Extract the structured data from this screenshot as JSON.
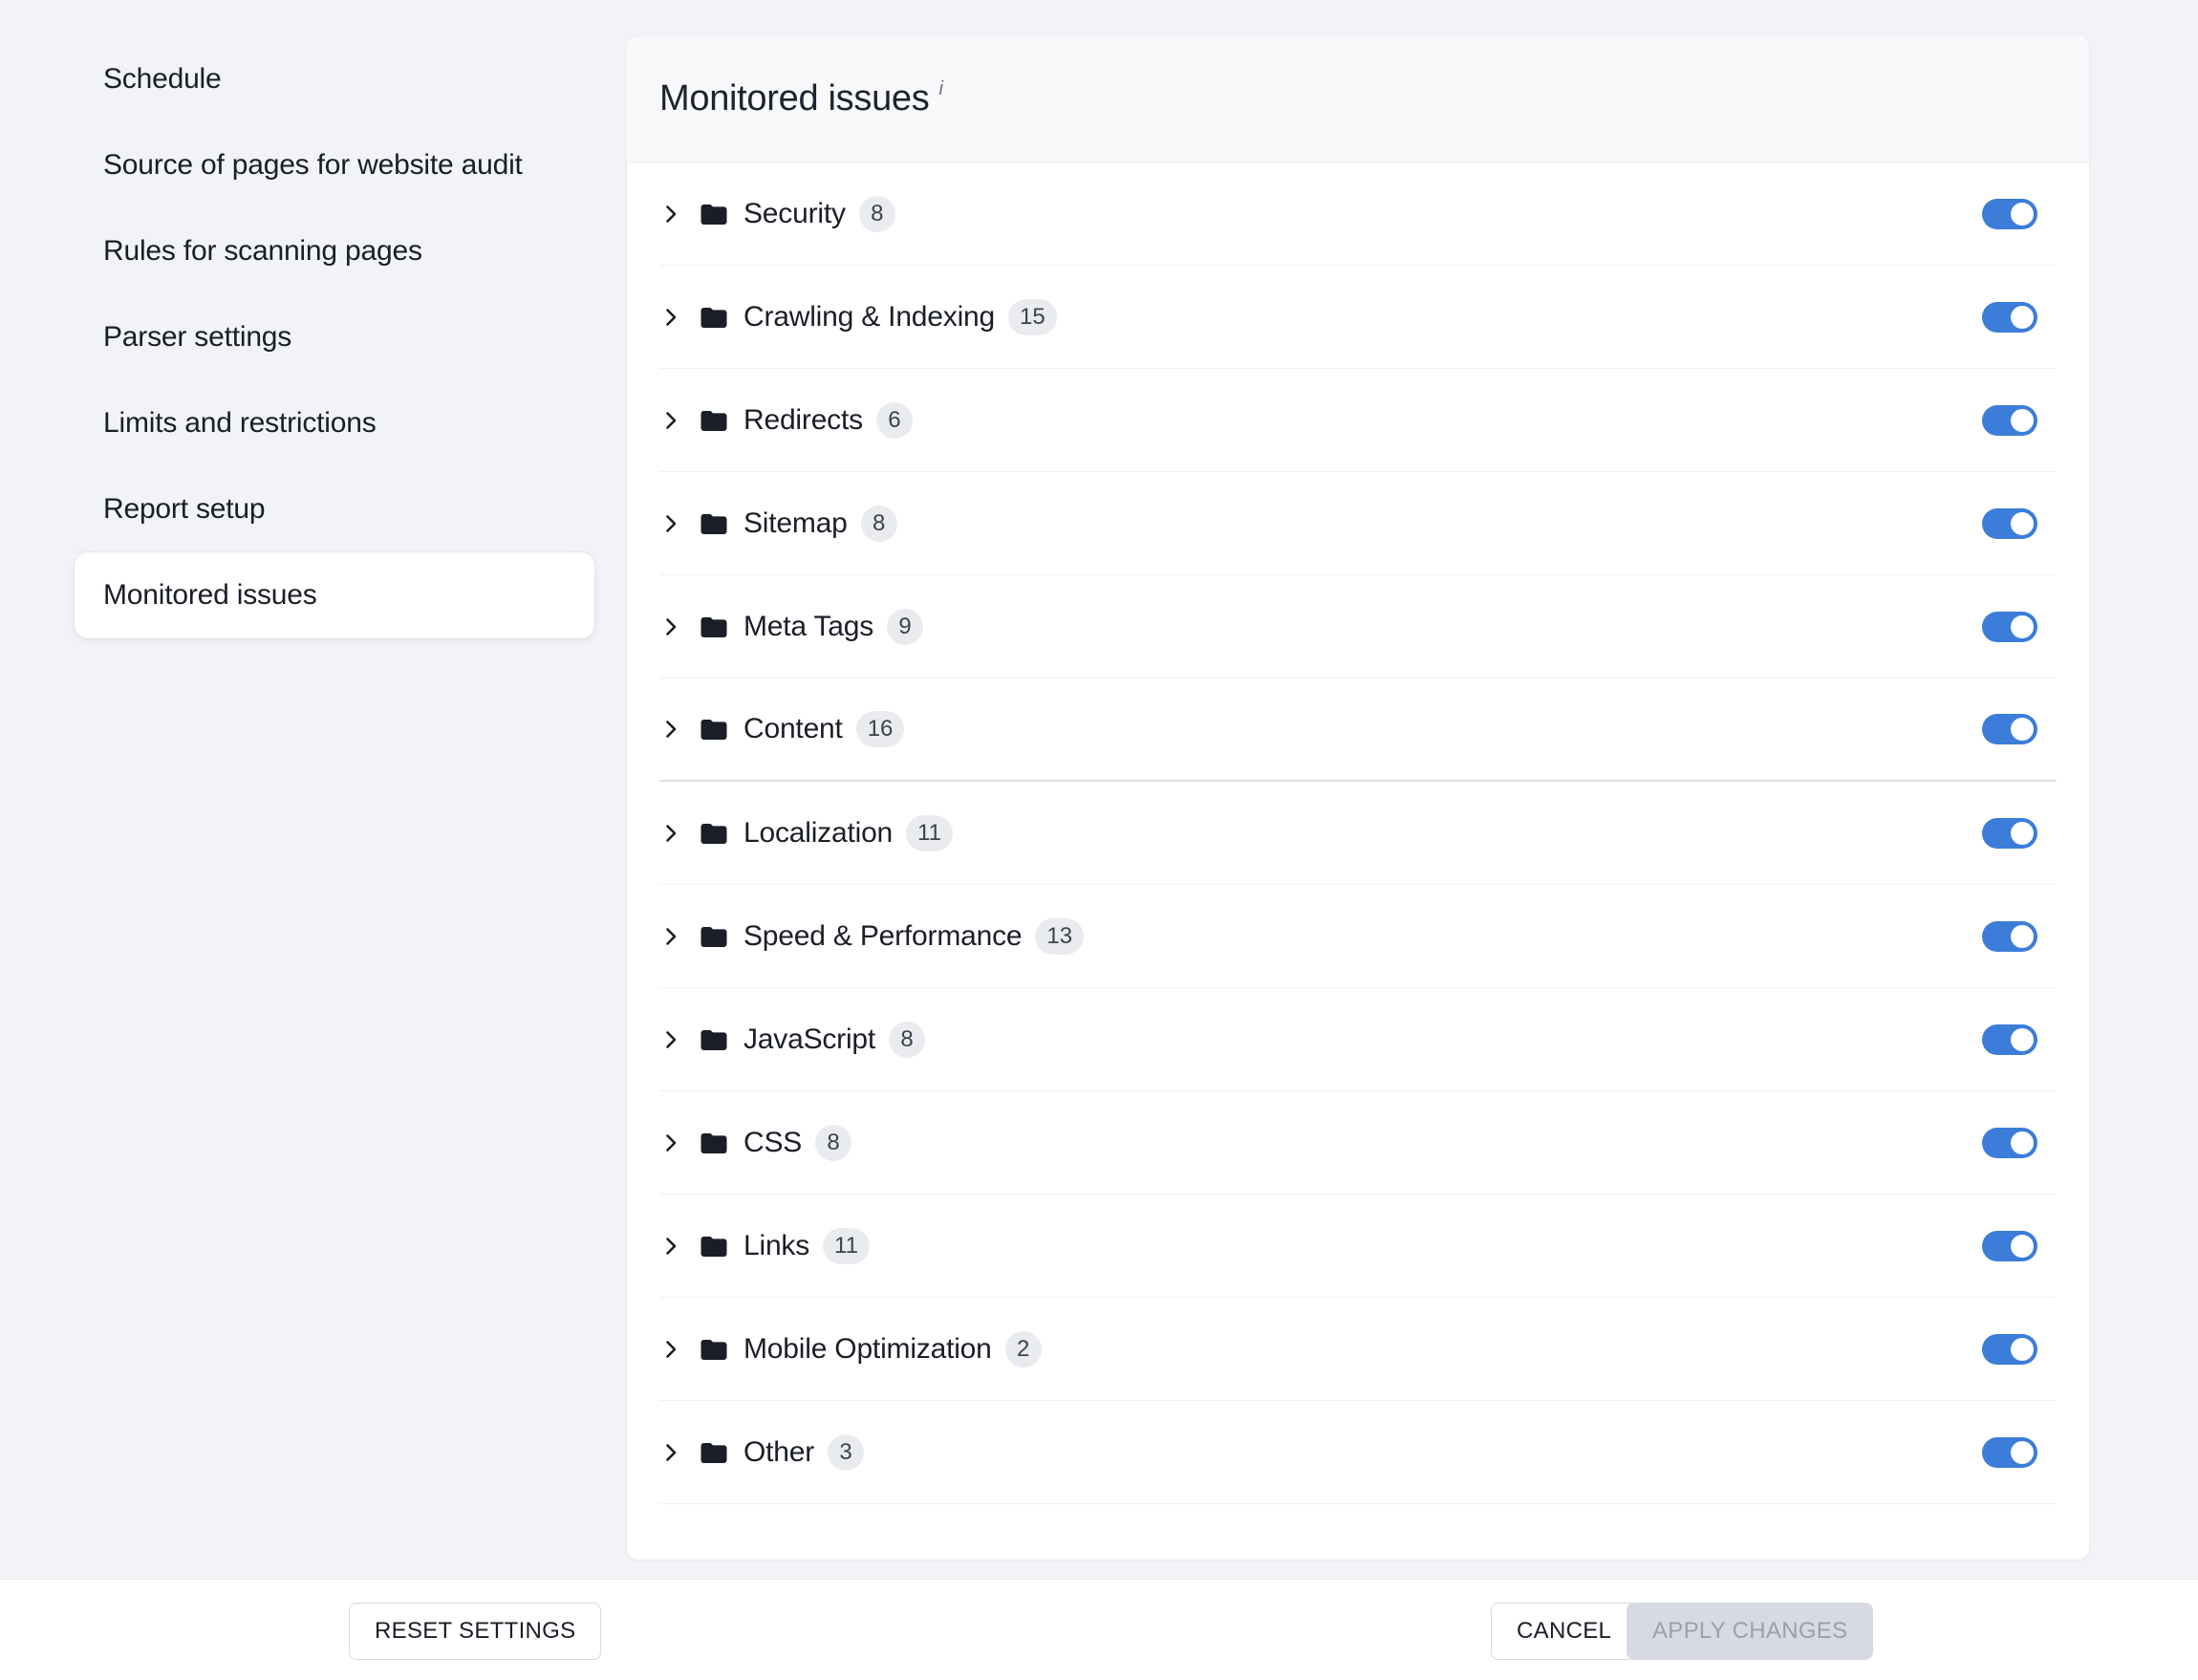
{
  "sidebar": {
    "items": [
      {
        "label": "Schedule",
        "active": false
      },
      {
        "label": "Source of pages for website audit",
        "active": false
      },
      {
        "label": "Rules for scanning pages",
        "active": false
      },
      {
        "label": "Parser settings",
        "active": false
      },
      {
        "label": "Limits and restrictions",
        "active": false
      },
      {
        "label": "Report setup",
        "active": false
      },
      {
        "label": "Monitored issues",
        "active": true
      }
    ]
  },
  "card": {
    "title": "Monitored issues",
    "info_icon": "i",
    "info_icon_name": "info-icon"
  },
  "colors": {
    "toggle_on": "#3b7dd8",
    "page_background": "#f1f3f7",
    "card_background": "#ffffff",
    "header_background": "#f8f9fb",
    "badge_background": "#e9ebef",
    "apply_disabled": "#d7dae1"
  },
  "rows": [
    {
      "label": "Security",
      "count": "8",
      "enabled": true,
      "expanded": false
    },
    {
      "label": "Crawling & Indexing",
      "count": "15",
      "enabled": true,
      "expanded": false
    },
    {
      "label": "Redirects",
      "count": "6",
      "enabled": true,
      "expanded": false
    },
    {
      "label": "Sitemap",
      "count": "8",
      "enabled": true,
      "expanded": false
    },
    {
      "label": "Meta Tags",
      "count": "9",
      "enabled": true,
      "expanded": false
    },
    {
      "label": "Content",
      "count": "16",
      "enabled": true,
      "expanded": false
    },
    {
      "label": "Localization",
      "count": "11",
      "enabled": true,
      "expanded": false
    },
    {
      "label": "Speed & Performance",
      "count": "13",
      "enabled": true,
      "expanded": false
    },
    {
      "label": "JavaScript",
      "count": "8",
      "enabled": true,
      "expanded": false
    },
    {
      "label": "CSS",
      "count": "8",
      "enabled": true,
      "expanded": false
    },
    {
      "label": "Links",
      "count": "11",
      "enabled": true,
      "expanded": false
    },
    {
      "label": "Mobile Optimization",
      "count": "2",
      "enabled": true,
      "expanded": false
    },
    {
      "label": "Other",
      "count": "3",
      "enabled": true,
      "expanded": false
    }
  ],
  "footer": {
    "reset_label": "RESET SETTINGS",
    "cancel_label": "CANCEL",
    "apply_label": "APPLY CHANGES",
    "apply_disabled": true
  }
}
